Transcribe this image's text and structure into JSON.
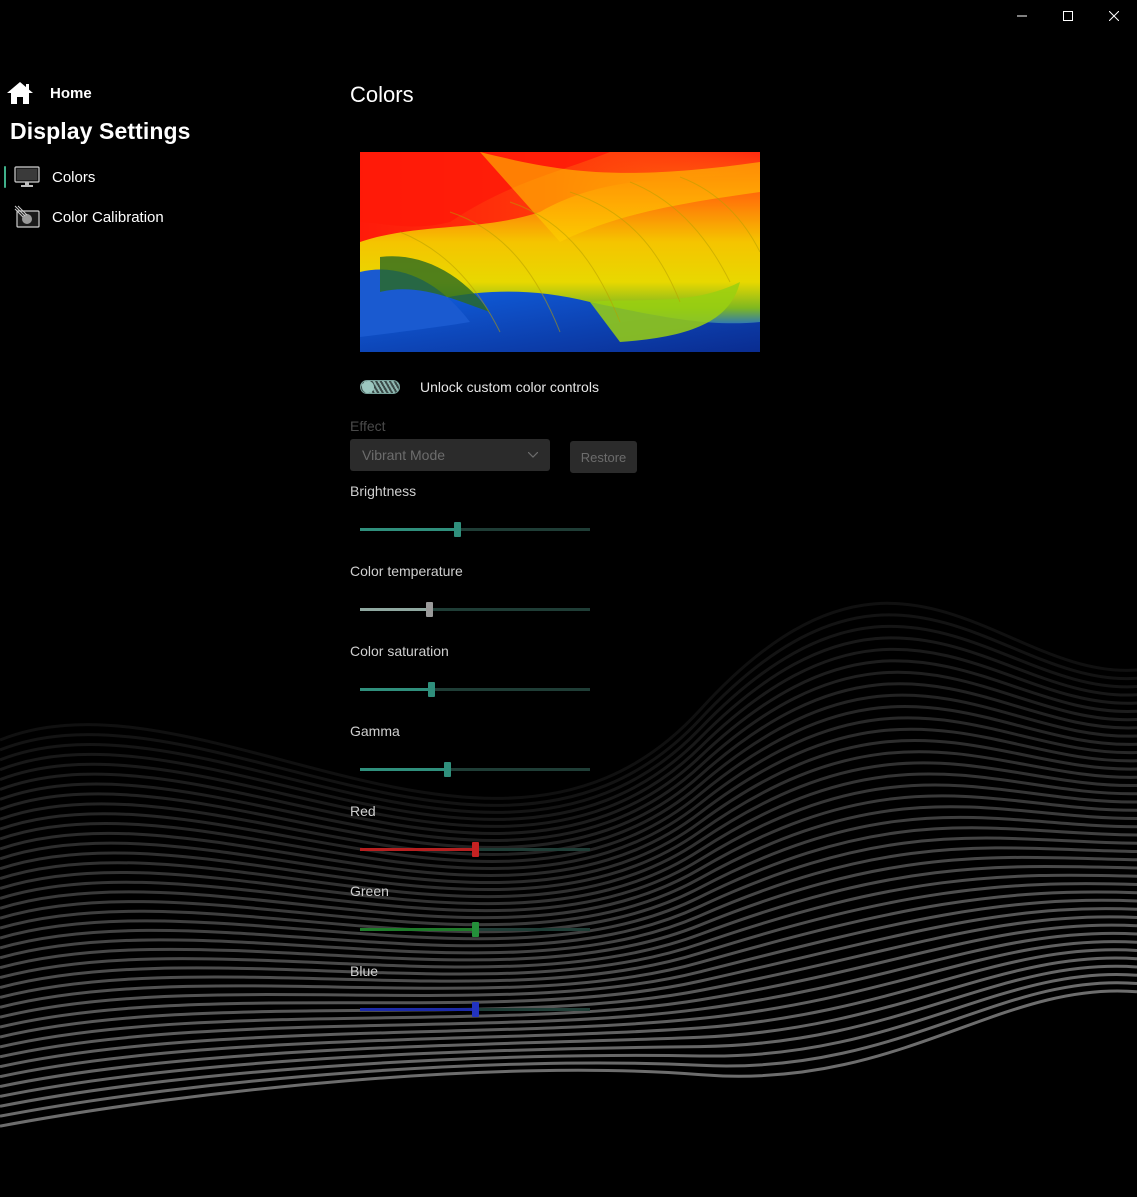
{
  "window": {
    "caption": {
      "minimize_icon": "minimize-icon",
      "maximize_icon": "maximize-icon",
      "close_icon": "close-icon"
    }
  },
  "sidebar": {
    "home_label": "Home",
    "section_title": "Display Settings",
    "items": [
      {
        "label": "Colors",
        "icon": "monitor-icon",
        "active": true
      },
      {
        "label": "Color Calibration",
        "icon": "calibration-icon",
        "active": false
      }
    ]
  },
  "main": {
    "title": "Colors",
    "toggle_label": "Unlock custom color controls",
    "effect": {
      "label": "Effect",
      "selected": "Vibrant Mode"
    },
    "restore_label": "Restore",
    "sliders": [
      {
        "label": "Brightness",
        "value": 0.42,
        "color": "#2f8f7c",
        "thumb": "#2f8f7c"
      },
      {
        "label": "Color temperature",
        "value": 0.3,
        "color": "#8fa8a0",
        "thumb": "#9a9a9a"
      },
      {
        "label": "Color saturation",
        "value": 0.31,
        "color": "#2f8f7c",
        "thumb": "#2f8f7c"
      },
      {
        "label": "Gamma",
        "value": 0.38,
        "color": "#2f8f7c",
        "thumb": "#2f8f7c"
      },
      {
        "label": "Red",
        "value": 0.5,
        "color": "#b51f1f",
        "thumb": "#c62222"
      },
      {
        "label": "Green",
        "value": 0.5,
        "color": "#1f7a2a",
        "thumb": "#24903a"
      },
      {
        "label": "Blue",
        "value": 0.5,
        "color": "#1c2aa8",
        "thumb": "#2233c0"
      }
    ]
  }
}
